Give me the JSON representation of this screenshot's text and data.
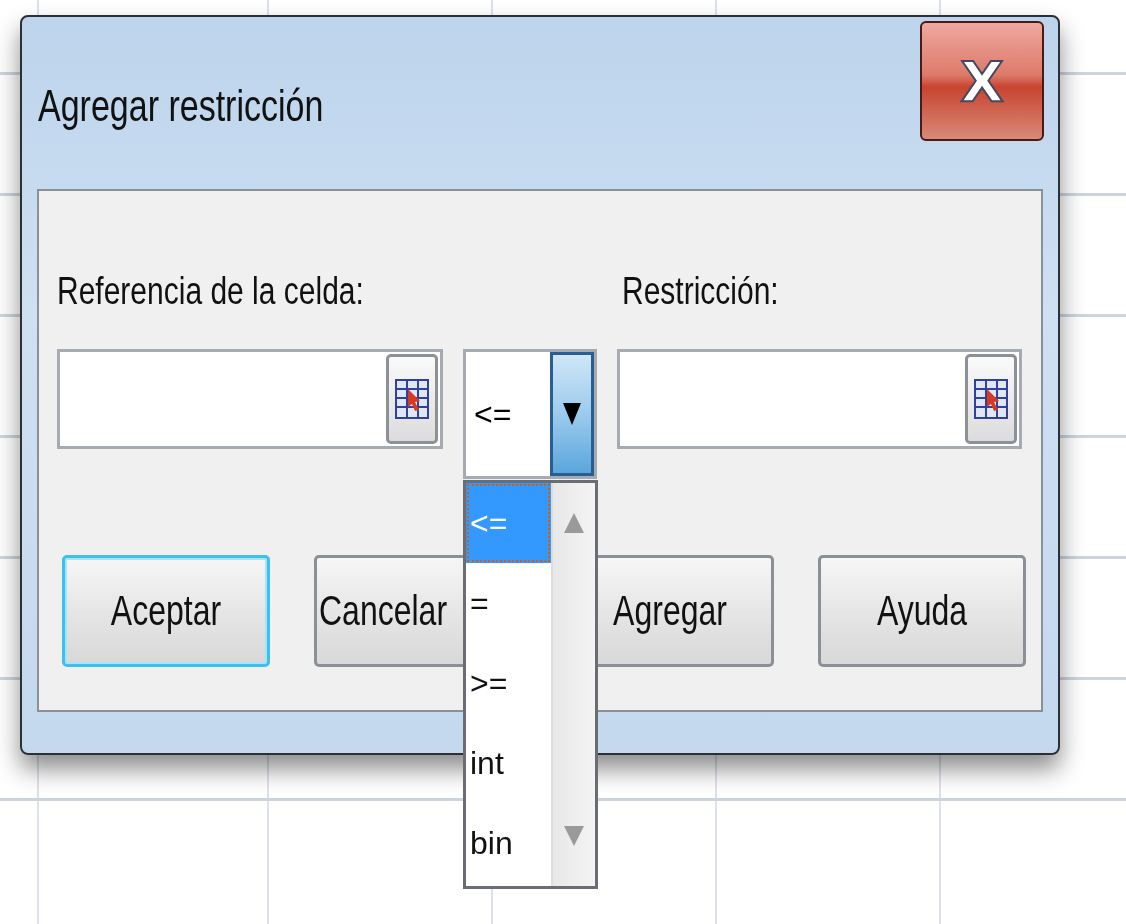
{
  "dialog": {
    "title": "Agregar restricción",
    "close_label": "X"
  },
  "cell_reference": {
    "label": "Referencia de la celda:"
  },
  "operator": {
    "value": "<=",
    "expanded": true,
    "options": [
      {
        "label": "<=",
        "selected": true
      },
      {
        "label": "=",
        "selected": false
      },
      {
        "label": ">=",
        "selected": false
      },
      {
        "label": "int",
        "selected": false
      },
      {
        "label": "bin",
        "selected": false
      }
    ]
  },
  "constraint": {
    "label": "Restricción:"
  },
  "buttons": [
    {
      "label": "Aceptar",
      "focused": true
    },
    {
      "label": "Cancelar",
      "focused": false
    },
    {
      "label": "Agregar",
      "focused": false
    },
    {
      "label": "Ayuda",
      "focused": false
    }
  ]
}
